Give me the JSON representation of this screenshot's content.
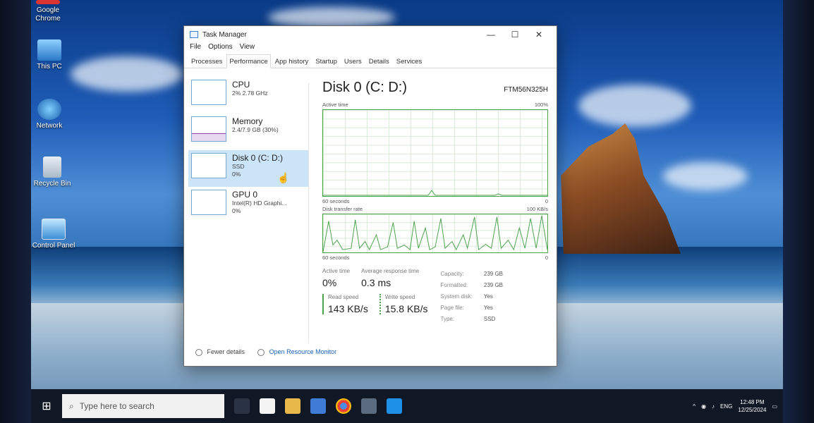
{
  "desktop": {
    "icons": [
      {
        "label": "Google Chrome"
      },
      {
        "label": "This PC"
      },
      {
        "label": "Network"
      },
      {
        "label": "Recycle Bin"
      },
      {
        "label": "Control Panel"
      }
    ]
  },
  "window": {
    "title": "Task Manager",
    "menu": [
      "File",
      "Options",
      "View"
    ],
    "tabs": [
      "Processes",
      "Performance",
      "App history",
      "Startup",
      "Users",
      "Details",
      "Services"
    ],
    "active_tab": "Performance",
    "controls": {
      "minimize": "—",
      "maximize": "☐",
      "close": "✕"
    }
  },
  "sidebar": {
    "items": [
      {
        "name": "CPU",
        "line1": "2% 2.78 GHz",
        "line2": ""
      },
      {
        "name": "Memory",
        "line1": "2.4/7.9 GB (30%)",
        "line2": ""
      },
      {
        "name": "Disk 0 (C: D:)",
        "line1": "SSD",
        "line2": "0%"
      },
      {
        "name": "GPU 0",
        "line1": "Intel(R) HD Graphi...",
        "line2": "0%"
      }
    ],
    "selected_index": 2
  },
  "main": {
    "title": "Disk 0 (C: D:)",
    "model": "FTM56N325H",
    "active_time": {
      "label": "Active time",
      "max": "100%",
      "time_label": "60 seconds",
      "min": "0"
    },
    "transfer_rate": {
      "label": "Disk transfer rate",
      "max": "100 KB/s",
      "time_label": "60 seconds",
      "min": "0"
    },
    "stats": {
      "active_time_label": "Active time",
      "active_time_value": "0%",
      "avg_response_label": "Average response time",
      "avg_response_value": "0.3 ms",
      "read_label": "Read speed",
      "read_value": "143 KB/s",
      "write_label": "Write speed",
      "write_value": "15.8 KB/s"
    },
    "properties": [
      {
        "key": "Capacity:",
        "value": "239 GB"
      },
      {
        "key": "Formatted:",
        "value": "239 GB"
      },
      {
        "key": "System disk:",
        "value": "Yes"
      },
      {
        "key": "Page file:",
        "value": "Yes"
      },
      {
        "key": "Type:",
        "value": "SSD"
      }
    ]
  },
  "footer": {
    "fewer_details": "Fewer details",
    "open_monitor": "Open Resource Monitor"
  },
  "taskbar": {
    "search_placeholder": "Type here to search",
    "lang": "ENG",
    "time": "12:48 PM",
    "date": "12/25/2024"
  },
  "colors": {
    "accent": "#4ea24e",
    "selection": "#cce4f7",
    "taskbar": "#101826"
  }
}
